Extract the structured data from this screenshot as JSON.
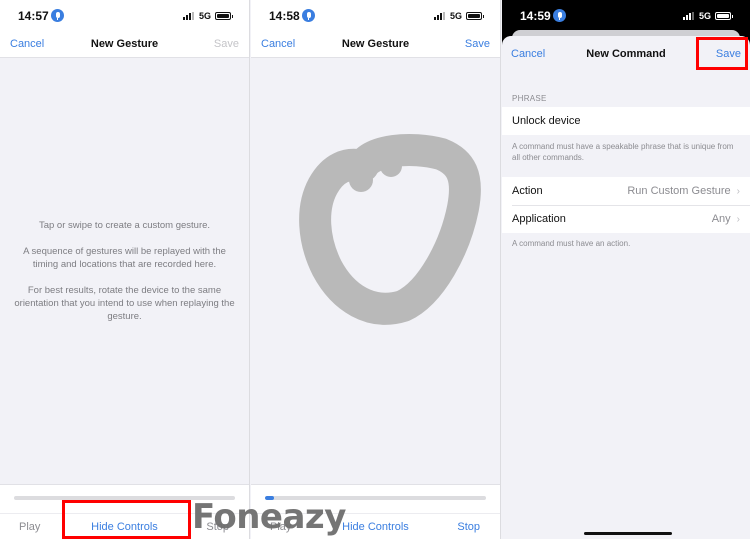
{
  "screens": [
    {
      "status": {
        "time": "14:57",
        "network": "5G"
      },
      "nav": {
        "cancel": "Cancel",
        "title": "New Gesture",
        "save": "Save",
        "save_enabled": false
      },
      "instructions": [
        "Tap or swipe to create a custom gesture.",
        "A sequence of gestures will be replayed with the timing and locations that are recorded here.",
        "For best results, rotate the device to the same orientation that you intend to use when replaying the gesture."
      ],
      "controls": {
        "play": "Play",
        "hide": "Hide Controls",
        "stop": "Stop",
        "progress": 0
      }
    },
    {
      "status": {
        "time": "14:58",
        "network": "5G"
      },
      "nav": {
        "cancel": "Cancel",
        "title": "New Gesture",
        "save": "Save",
        "save_enabled": true
      },
      "controls": {
        "play": "Play",
        "hide": "Hide Controls",
        "stop": "Stop",
        "progress": 0.04
      }
    },
    {
      "status": {
        "time": "14:59",
        "network": "5G"
      },
      "nav": {
        "cancel": "Cancel",
        "title": "New Command",
        "save": "Save"
      },
      "phrase_section": {
        "header": "PHRASE",
        "value": "Unlock device",
        "footer": "A command must have a speakable phrase that is unique from all other commands."
      },
      "action_section": {
        "rows": [
          {
            "label": "Action",
            "value": "Run Custom Gesture"
          },
          {
            "label": "Application",
            "value": "Any"
          }
        ],
        "footer": "A command must have an action."
      }
    }
  ],
  "watermark": "Foneazy",
  "colors": {
    "accent": "#3a7ee0",
    "highlight": "#ff0000",
    "gesture_stroke": "#b9b9b9"
  }
}
